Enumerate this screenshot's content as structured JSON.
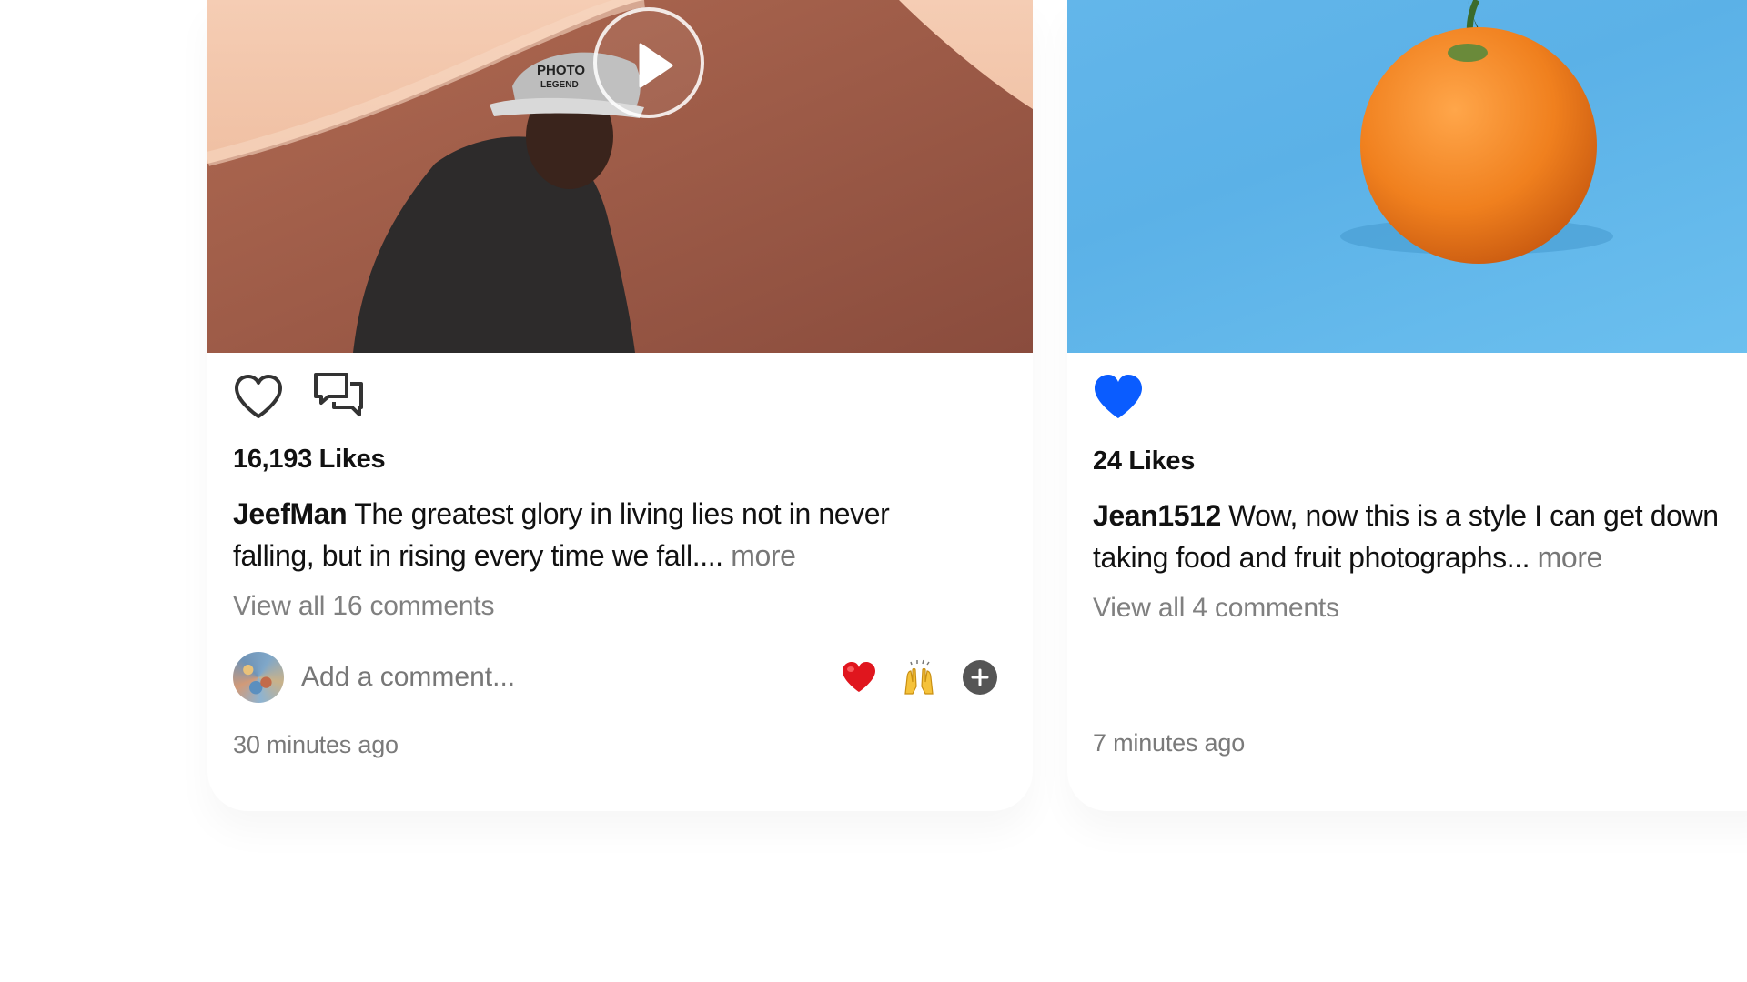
{
  "posts": [
    {
      "likes": "16,193 Likes",
      "username": "JeefMan",
      "caption_line1": "The greatest glory in living lies not in never",
      "caption_line2": "falling, but in rising every time we fall....",
      "more": "more",
      "view_comments": "View all 16 comments",
      "comment_placeholder": "Add a comment...",
      "timestamp": "30 minutes ago",
      "liked": false,
      "media_type": "video",
      "icons": [
        "heart-outline-icon",
        "comment-icon",
        "play-icon",
        "red-heart-emoji-icon",
        "raised-hands-emoji-icon",
        "plus-icon"
      ]
    },
    {
      "likes": "24 Likes",
      "username": "Jean1512",
      "caption_line1": "Wow, now this is a style I can get down",
      "caption_line2": "taking food and fruit photographs...",
      "more": "more",
      "view_comments": "View all 4 comments",
      "timestamp": "7 minutes ago",
      "liked": true,
      "media_type": "image",
      "icons": [
        "heart-filled-icon"
      ]
    }
  ],
  "colors": {
    "like_active": "#0A5CFF",
    "secondary_text": "#808080",
    "primary_text": "#111111",
    "plus_button": "#555555",
    "photo_background_blue": "#5BB1E7"
  }
}
